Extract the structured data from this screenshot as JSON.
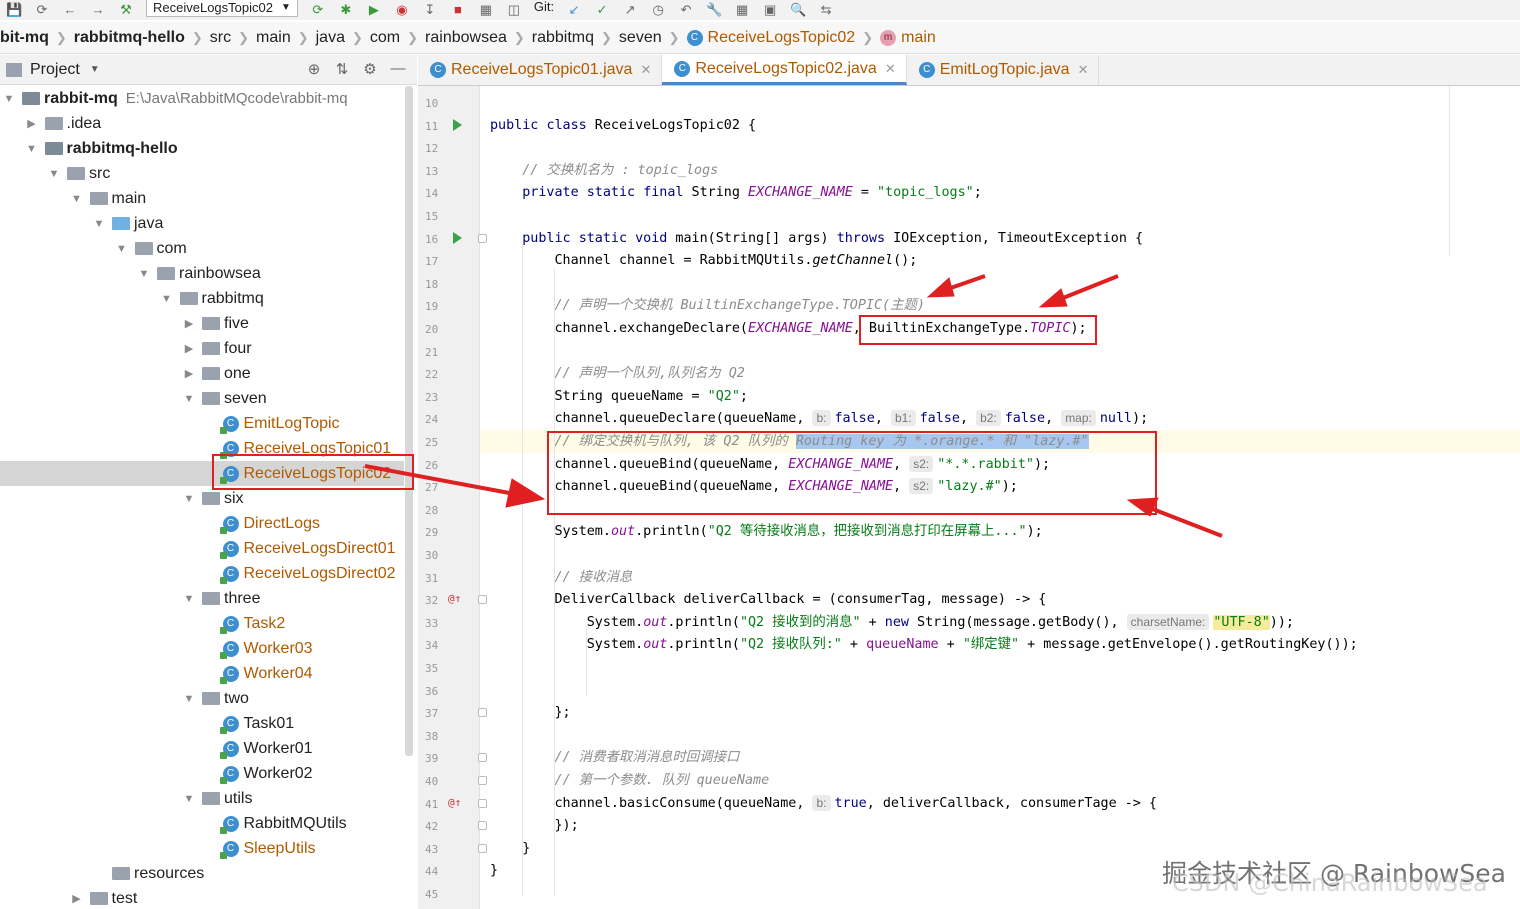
{
  "toolbar": {
    "run_config": "ReceiveLogsTopic02",
    "git_label": "Git:"
  },
  "breadcrumb": [
    "bit-mq",
    "rabbitmq-hello",
    "src",
    "main",
    "java",
    "com",
    "rainbowsea",
    "rabbitmq",
    "seven",
    "ReceiveLogsTopic02",
    "main"
  ],
  "project_panel": {
    "title": "Project",
    "tree": [
      {
        "label": "rabbit-mq",
        "path": "E:\\Java\\RabbitMQcode\\rabbit-mq",
        "kind": "project",
        "depth": 0,
        "expanded": true
      },
      {
        "label": ".idea",
        "kind": "folder",
        "depth": 1,
        "expanded": false
      },
      {
        "label": "rabbitmq-hello",
        "kind": "module",
        "depth": 1,
        "expanded": true
      },
      {
        "label": "src",
        "kind": "folder",
        "depth": 2,
        "expanded": true
      },
      {
        "label": "main",
        "kind": "folder",
        "depth": 3,
        "expanded": true
      },
      {
        "label": "java",
        "kind": "source-folder",
        "depth": 4,
        "expanded": true
      },
      {
        "label": "com",
        "kind": "package",
        "depth": 5,
        "expanded": true
      },
      {
        "label": "rainbowsea",
        "kind": "package",
        "depth": 6,
        "expanded": true
      },
      {
        "label": "rabbitmq",
        "kind": "package",
        "depth": 7,
        "expanded": true
      },
      {
        "label": "five",
        "kind": "package",
        "depth": 8,
        "expanded": false
      },
      {
        "label": "four",
        "kind": "package",
        "depth": 8,
        "expanded": false
      },
      {
        "label": "one",
        "kind": "package",
        "depth": 8,
        "expanded": false
      },
      {
        "label": "seven",
        "kind": "package",
        "depth": 8,
        "expanded": true
      },
      {
        "label": "EmitLogTopic",
        "kind": "class",
        "depth": 9
      },
      {
        "label": "ReceiveLogsTopic01",
        "kind": "class",
        "depth": 9
      },
      {
        "label": "ReceiveLogsTopic02",
        "kind": "class",
        "depth": 9,
        "selected": true
      },
      {
        "label": "six",
        "kind": "package",
        "depth": 8,
        "expanded": true
      },
      {
        "label": "DirectLogs",
        "kind": "class",
        "depth": 9
      },
      {
        "label": "ReceiveLogsDirect01",
        "kind": "class",
        "depth": 9
      },
      {
        "label": "ReceiveLogsDirect02",
        "kind": "class",
        "depth": 9
      },
      {
        "label": "three",
        "kind": "package",
        "depth": 8,
        "expanded": true
      },
      {
        "label": "Task2",
        "kind": "class",
        "depth": 9
      },
      {
        "label": "Worker03",
        "kind": "class",
        "depth": 9
      },
      {
        "label": "Worker04",
        "kind": "class",
        "depth": 9
      },
      {
        "label": "two",
        "kind": "package",
        "depth": 8,
        "expanded": true
      },
      {
        "label": "Task01",
        "kind": "class",
        "depth": 9,
        "plain": true
      },
      {
        "label": "Worker01",
        "kind": "class",
        "depth": 9,
        "plain": true
      },
      {
        "label": "Worker02",
        "kind": "class",
        "depth": 9,
        "plain": true
      },
      {
        "label": "utils",
        "kind": "package",
        "depth": 8,
        "expanded": true
      },
      {
        "label": "RabbitMQUtils",
        "kind": "class",
        "depth": 9,
        "plain": true
      },
      {
        "label": "SleepUtils",
        "kind": "class",
        "depth": 9
      },
      {
        "label": "resources",
        "kind": "folder",
        "depth": 4
      },
      {
        "label": "test",
        "kind": "folder",
        "depth": 3,
        "expanded": false
      }
    ]
  },
  "editor": {
    "tabs": [
      {
        "label": "ReceiveLogsTopic01.java",
        "active": false
      },
      {
        "label": "ReceiveLogsTopic02.java",
        "active": true
      },
      {
        "label": "EmitLogTopic.java",
        "active": false
      }
    ],
    "line_numbers": [
      "10",
      "11",
      "12",
      "13",
      "14",
      "15",
      "16",
      "17",
      "18",
      "19",
      "20",
      "21",
      "22",
      "23",
      "24",
      "25",
      "26",
      "27",
      "28",
      "29",
      "30",
      "31",
      "32",
      "33",
      "34",
      "35",
      "36",
      "37",
      "38",
      "39",
      "40",
      "41",
      "42",
      "43",
      "44",
      "45"
    ],
    "code_lines": [
      {
        "n": "10",
        "text": ""
      },
      {
        "n": "11",
        "text": "public class ReceiveLogsTopic02 {"
      },
      {
        "n": "12",
        "text": ""
      },
      {
        "n": "13",
        "text": "    // 交换机名为 : topic_logs"
      },
      {
        "n": "14",
        "text": "    private static final String EXCHANGE_NAME = \"topic_logs\";"
      },
      {
        "n": "15",
        "text": ""
      },
      {
        "n": "16",
        "text": "    public static void main(String[] args) throws IOException, TimeoutException {"
      },
      {
        "n": "17",
        "text": "        Channel channel = RabbitMQUtils.getChannel();"
      },
      {
        "n": "18",
        "text": ""
      },
      {
        "n": "19",
        "text": "        // 声明一个交换机 BuiltinExchangeType.TOPIC(主题)"
      },
      {
        "n": "20",
        "text": "        channel.exchangeDeclare(EXCHANGE_NAME, BuiltinExchangeType.TOPIC);"
      },
      {
        "n": "21",
        "text": ""
      },
      {
        "n": "22",
        "text": "        // 声明一个队列,队列名为 Q2"
      },
      {
        "n": "23",
        "text": "        String queueName = \"Q2\";"
      },
      {
        "n": "24",
        "text": "        channel.queueDeclare(queueName, b: false, b1: false, b2: false, map: null);"
      },
      {
        "n": "25",
        "text": "        // 绑定交换机与队列, 该 Q2 队列的 Routing key 为 *.orange.* 和 \"lazy.#\""
      },
      {
        "n": "26",
        "text": "        channel.queueBind(queueName, EXCHANGE_NAME, s2: \"*.*.rabbit\");"
      },
      {
        "n": "27",
        "text": "        channel.queueBind(queueName, EXCHANGE_NAME, s2: \"lazy.#\");"
      },
      {
        "n": "28",
        "text": ""
      },
      {
        "n": "29",
        "text": "        System.out.println(\"Q2 等待接收消息，把接收到消息打印在屏幕上...\");"
      },
      {
        "n": "30",
        "text": ""
      },
      {
        "n": "31",
        "text": "        // 接收消息"
      },
      {
        "n": "32",
        "text": "        DeliverCallback deliverCallback = (consumerTag, message) -> {"
      },
      {
        "n": "33",
        "text": "            System.out.println(\"Q2 接收到的消息\" + new String(message.getBody(), charsetName: \"UTF-8\"));"
      },
      {
        "n": "34",
        "text": "            System.out.println(\"Q2 接收队列:\" + queueName + \"绑定键\" + message.getEnvelope().getRoutingKey());"
      },
      {
        "n": "35",
        "text": ""
      },
      {
        "n": "36",
        "text": ""
      },
      {
        "n": "37",
        "text": "        };"
      },
      {
        "n": "38",
        "text": ""
      },
      {
        "n": "39",
        "text": "        // 消费者取消消息时回调接口"
      },
      {
        "n": "40",
        "text": "        // 第一个参数. 队列 queueName"
      },
      {
        "n": "41",
        "text": "        channel.basicConsume(queueName, b: true, deliverCallback, consumerTage -> {"
      },
      {
        "n": "42",
        "text": "        });"
      },
      {
        "n": "43",
        "text": "    }"
      },
      {
        "n": "44",
        "text": "}"
      },
      {
        "n": "45",
        "text": ""
      }
    ],
    "hints": {
      "b": "b:",
      "b1": "b1:",
      "b2": "b2:",
      "map": "map:",
      "s2": "s2:",
      "charset": "charsetName:"
    }
  },
  "watermark": {
    "primary": "掘金技术社区 @ RainbowSea",
    "secondary": "CSDN @ChinaRainbowSea"
  },
  "colors": {
    "accent": "#4a88c7",
    "annotation_red": "#e02020",
    "class_file": "#b05a00"
  }
}
